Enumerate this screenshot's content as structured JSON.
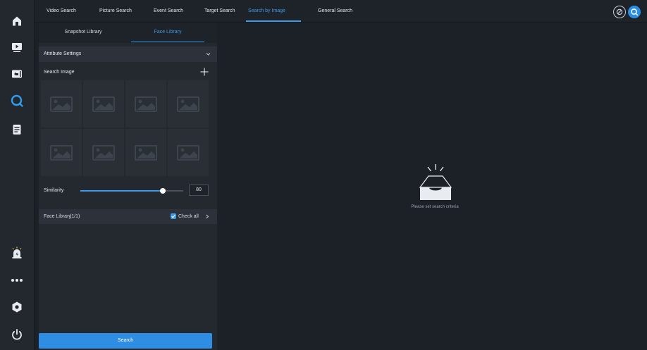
{
  "nav": {
    "items": [
      {
        "icon": "home-icon",
        "active": false
      },
      {
        "icon": "playback-icon",
        "active": false
      },
      {
        "icon": "back-icon",
        "active": false
      },
      {
        "icon": "search-icon",
        "active": true
      },
      {
        "icon": "document-icon",
        "active": false
      },
      {
        "icon": "alarm-icon",
        "active": false
      },
      {
        "icon": "more-icon",
        "active": false
      },
      {
        "icon": "settings-icon",
        "active": false
      },
      {
        "icon": "power-icon",
        "active": false
      }
    ]
  },
  "topbar": {
    "tabs": [
      {
        "label": "Video Search"
      },
      {
        "label": "Picture Search"
      },
      {
        "label": "Event Search"
      },
      {
        "label": "Target Search"
      },
      {
        "label": "Search by Image"
      },
      {
        "label": "General Search"
      }
    ],
    "active_tab": "Search by Image"
  },
  "panel": {
    "subtabs": [
      {
        "label": "Snapshot Library"
      },
      {
        "label": "Face Library"
      }
    ],
    "active_subtab": "Face Library",
    "attribute_settings": "Attribute Settings",
    "search_image": "Search Image",
    "similarity_label": "Similarity",
    "similarity_value": "80",
    "similarity_level": 0.8,
    "face_library_label": "Face Library",
    "face_library_count": "(1/1)",
    "check_all_label": "Check all",
    "search_button": "Search"
  },
  "empty_state": {
    "message": "Please set search criteria"
  },
  "colors": {
    "accent": "#3d9be9",
    "background": "#1c2027",
    "panel": "#24282f"
  }
}
